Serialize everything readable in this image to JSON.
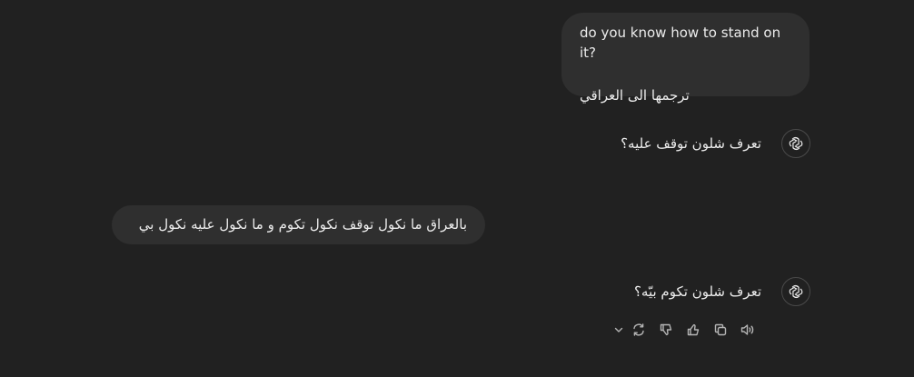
{
  "messages": {
    "user_1": {
      "line_en": "do you know how to stand on it?",
      "line_ar": "ترجمها الى العراقي"
    },
    "assistant_1": {
      "text": "تعرف شلون توقف عليه؟"
    },
    "user_2": {
      "text": "بالعراق ما نكول توقف نكول تكوم و ما نكول عليه نكول بي"
    },
    "assistant_2": {
      "text": "تعرف شلون تكوم بيّه؟"
    }
  },
  "actions": [
    {
      "icon": "speaker-icon"
    },
    {
      "icon": "copy-icon"
    },
    {
      "icon": "thumbs-up-icon"
    },
    {
      "icon": "thumbs-down-icon"
    },
    {
      "icon": "regenerate-icon"
    },
    {
      "icon": "chevron-down-icon"
    }
  ],
  "colors": {
    "background": "#212121",
    "bubble": "#2f2f2f",
    "text": "#ececec",
    "icon": "#b4b4b4"
  }
}
